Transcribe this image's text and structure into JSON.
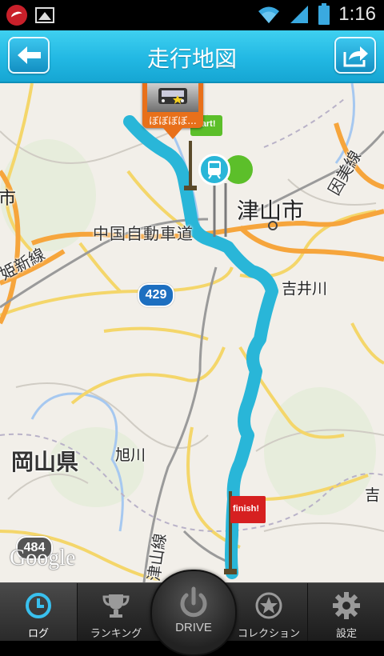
{
  "status_bar": {
    "time": "1:16"
  },
  "header": {
    "title": "走行地図"
  },
  "map": {
    "labels": {
      "tsuyama_city": "津山市",
      "chugoku_expressway": "中国自動車道",
      "innbi_line": "因美線",
      "kisen_line": "姫新線",
      "shi_left": "市",
      "yoshii_river": "吉井川",
      "asahi_river": "旭川",
      "okayama_pref": "岡山県",
      "tsuyama_line": "津山線",
      "yoshi_right": "吉"
    },
    "route_badges": {
      "r429": "429",
      "r484": "484"
    },
    "attribution": "Google",
    "photo_marker_label": "ぼぼぼぼ...",
    "start_flag": "start!",
    "finish_flag": "finish!",
    "colors": {
      "route": "#29b6d8",
      "accent": "#22b8e3",
      "finish": "#d62020",
      "start": "#5cbf2a"
    }
  },
  "nav": {
    "items": [
      {
        "label": "ログ",
        "icon": "clock-icon"
      },
      {
        "label": "ランキング",
        "icon": "trophy-icon"
      },
      {
        "label": "DRIVE",
        "icon": "power-icon"
      },
      {
        "label": "コレクション",
        "icon": "star-icon"
      },
      {
        "label": "設定",
        "icon": "gear-icon"
      }
    ]
  }
}
